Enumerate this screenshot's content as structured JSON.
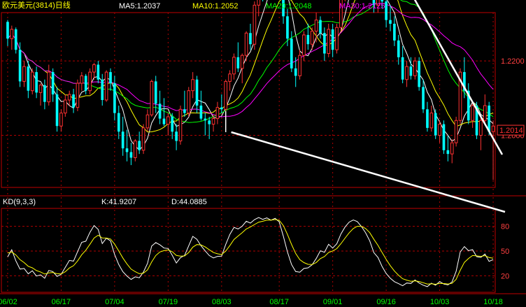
{
  "header": {
    "title": "欧元美元(3814)日线",
    "ma_labels": [
      {
        "text": "MA5:1.2037",
        "color": "#ffffff"
      },
      {
        "text": "MA10:1.2052",
        "color": "#ffff00"
      },
      {
        "text": "MA20:1.2048",
        "color": "#00ff00"
      },
      {
        "text": "MA30:1.2125",
        "color": "#ff00ff"
      }
    ]
  },
  "colors": {
    "up": "#ff3232",
    "down": "#00ffff",
    "grid": "#b00000",
    "axis": "#c00000",
    "ma5": "#ffffff",
    "ma10": "#ffff00",
    "ma20": "#00ff00",
    "ma30": "#ff00ff",
    "k_line": "#ffffff",
    "d_line": "#ffff00",
    "trend": "#ffffff",
    "label_green": "#00ff00"
  },
  "chart_data": [
    {
      "type": "candlestick",
      "title": "欧元美元(3814)日线",
      "x": [
        "06/02",
        "06/17",
        "07/04",
        "07/19",
        "08/03",
        "08/17",
        "09/01",
        "09/16",
        "10/03",
        "10/18"
      ],
      "ylim": [
        1.186,
        1.233
      ],
      "yticks": [
        1.2,
        1.22,
        1.24
      ],
      "current_price": 1.2014,
      "ohlc": [
        [
          1.2305,
          1.231,
          1.224,
          1.226
        ],
        [
          1.226,
          1.2295,
          1.223,
          1.2285
        ],
        [
          1.2285,
          1.229,
          1.222,
          1.223
        ],
        [
          1.223,
          1.225,
          1.213,
          1.2145
        ],
        [
          1.2145,
          1.22,
          1.213,
          1.2185
        ],
        [
          1.2185,
          1.22,
          1.21,
          1.212
        ],
        [
          1.212,
          1.218,
          1.211,
          1.217
        ],
        [
          1.217,
          1.2185,
          1.21,
          1.2115
        ],
        [
          1.2115,
          1.214,
          1.208,
          1.2135
        ],
        [
          1.2135,
          1.215,
          1.207,
          1.209
        ],
        [
          1.209,
          1.219,
          1.208,
          1.217
        ],
        [
          1.217,
          1.218,
          1.209,
          1.211
        ],
        [
          1.211,
          1.213,
          1.201,
          1.2025
        ],
        [
          1.2025,
          1.207,
          1.201,
          1.206
        ],
        [
          1.206,
          1.211,
          1.205,
          1.2095
        ],
        [
          1.2095,
          1.212,
          1.208,
          1.211
        ],
        [
          1.211,
          1.2125,
          1.206,
          1.2075
        ],
        [
          1.2075,
          1.215,
          1.2065,
          1.214
        ],
        [
          1.214,
          1.217,
          1.212,
          1.216
        ],
        [
          1.216,
          1.2165,
          1.211,
          1.212
        ],
        [
          1.212,
          1.218,
          1.211,
          1.217
        ],
        [
          1.217,
          1.2195,
          1.215,
          1.219
        ],
        [
          1.219,
          1.22,
          1.214,
          1.215
        ],
        [
          1.215,
          1.2165,
          1.208,
          1.2095
        ],
        [
          1.2095,
          1.2175,
          1.209,
          1.217
        ],
        [
          1.217,
          1.218,
          1.212,
          1.214
        ],
        [
          1.214,
          1.216,
          1.204,
          1.206
        ],
        [
          1.206,
          1.208,
          1.199,
          1.201
        ],
        [
          1.201,
          1.205,
          1.1945,
          1.1965
        ],
        [
          1.1965,
          1.2015,
          1.193,
          1.1955
        ],
        [
          1.1955,
          1.198,
          1.192,
          1.194
        ],
        [
          1.194,
          1.199,
          1.193,
          1.1985
        ],
        [
          1.1985,
          1.201,
          1.195,
          1.196
        ],
        [
          1.196,
          1.203,
          1.195,
          1.202
        ],
        [
          1.202,
          1.207,
          1.201,
          1.2055
        ],
        [
          1.2055,
          1.215,
          1.205,
          1.2145
        ],
        [
          1.2145,
          1.216,
          1.206,
          1.2085
        ],
        [
          1.2085,
          1.212,
          1.203,
          1.2045
        ],
        [
          1.2045,
          1.21,
          1.2025,
          1.203
        ],
        [
          1.203,
          1.206,
          1.2,
          1.205
        ],
        [
          1.205,
          1.206,
          1.199,
          1.201
        ],
        [
          1.201,
          1.203,
          1.196,
          1.1985
        ],
        [
          1.1985,
          1.208,
          1.1975,
          1.207
        ],
        [
          1.207,
          1.212,
          1.205,
          1.206
        ],
        [
          1.206,
          1.213,
          1.205,
          1.212
        ],
        [
          1.212,
          1.217,
          1.21,
          1.215
        ],
        [
          1.215,
          1.216,
          1.206,
          1.208
        ],
        [
          1.208,
          1.212,
          1.204,
          1.2045
        ],
        [
          1.2045,
          1.206,
          1.2,
          1.204
        ],
        [
          1.204,
          1.205,
          1.199,
          1.203
        ],
        [
          1.203,
          1.2055,
          1.201,
          1.2045
        ],
        [
          1.2045,
          1.209,
          1.203,
          1.2075
        ],
        [
          1.2075,
          1.211,
          1.206,
          1.207
        ],
        [
          1.207,
          1.215,
          1.2065,
          1.2145
        ],
        [
          1.2145,
          1.2175,
          1.212,
          1.2165
        ],
        [
          1.2165,
          1.222,
          1.215,
          1.221
        ],
        [
          1.221,
          1.225,
          1.217,
          1.218
        ],
        [
          1.218,
          1.222,
          1.214,
          1.2215
        ],
        [
          1.2215,
          1.228,
          1.22,
          1.2275
        ],
        [
          1.2275,
          1.23,
          1.223,
          1.2245
        ],
        [
          1.2245,
          1.236,
          1.223,
          1.235
        ],
        [
          1.235,
          1.24,
          1.232,
          1.2385
        ],
        [
          1.2385,
          1.243,
          1.236,
          1.238
        ],
        [
          1.238,
          1.246,
          1.237,
          1.244
        ],
        [
          1.244,
          1.247,
          1.239,
          1.241
        ],
        [
          1.241,
          1.249,
          1.24,
          1.247
        ],
        [
          1.247,
          1.25,
          1.241,
          1.243
        ],
        [
          1.243,
          1.245,
          1.23,
          1.232
        ],
        [
          1.232,
          1.234,
          1.224,
          1.226
        ],
        [
          1.226,
          1.228,
          1.217,
          1.218
        ],
        [
          1.218,
          1.221,
          1.213,
          1.216
        ],
        [
          1.216,
          1.223,
          1.215,
          1.2215
        ],
        [
          1.2215,
          1.228,
          1.22,
          1.227
        ],
        [
          1.227,
          1.23,
          1.223,
          1.2245
        ],
        [
          1.2245,
          1.229,
          1.223,
          1.228
        ],
        [
          1.228,
          1.233,
          1.225,
          1.231
        ],
        [
          1.231,
          1.232,
          1.226,
          1.2275
        ],
        [
          1.2275,
          1.229,
          1.22,
          1.222
        ],
        [
          1.222,
          1.23,
          1.221,
          1.2285
        ],
        [
          1.2285,
          1.23,
          1.221,
          1.223
        ],
        [
          1.223,
          1.23,
          1.222,
          1.229
        ],
        [
          1.229,
          1.238,
          1.228,
          1.237
        ],
        [
          1.237,
          1.246,
          1.236,
          1.245
        ],
        [
          1.245,
          1.252,
          1.243,
          1.251
        ],
        [
          1.251,
          1.262,
          1.249,
          1.259
        ],
        [
          1.259,
          1.264,
          1.254,
          1.256
        ],
        [
          1.256,
          1.258,
          1.247,
          1.25
        ],
        [
          1.25,
          1.253,
          1.243,
          1.2455
        ],
        [
          1.2455,
          1.248,
          1.238,
          1.24
        ],
        [
          1.24,
          1.242,
          1.233,
          1.235
        ],
        [
          1.235,
          1.244,
          1.233,
          1.2425
        ],
        [
          1.2425,
          1.243,
          1.234,
          1.236
        ],
        [
          1.236,
          1.237,
          1.229,
          1.231
        ],
        [
          1.231,
          1.235,
          1.228,
          1.23
        ],
        [
          1.23,
          1.232,
          1.224,
          1.2255
        ],
        [
          1.2255,
          1.227,
          1.219,
          1.221
        ],
        [
          1.221,
          1.224,
          1.214,
          1.215
        ],
        [
          1.215,
          1.22,
          1.213,
          1.2185
        ],
        [
          1.2185,
          1.221,
          1.215,
          1.216
        ],
        [
          1.216,
          1.221,
          1.215,
          1.22
        ],
        [
          1.22,
          1.221,
          1.212,
          1.213
        ],
        [
          1.213,
          1.215,
          1.206,
          1.207
        ],
        [
          1.207,
          1.209,
          1.201,
          1.202
        ],
        [
          1.202,
          1.208,
          1.201,
          1.206
        ],
        [
          1.206,
          1.207,
          1.199,
          1.2
        ],
        [
          1.2,
          1.204,
          1.198,
          1.203
        ],
        [
          1.203,
          1.204,
          1.195,
          1.196
        ],
        [
          1.196,
          1.2,
          1.193,
          1.195
        ],
        [
          1.195,
          1.199,
          1.1925,
          1.198
        ],
        [
          1.198,
          1.205,
          1.197,
          1.204
        ],
        [
          1.204,
          1.218,
          1.203,
          1.217
        ],
        [
          1.217,
          1.221,
          1.21,
          1.212
        ],
        [
          1.212,
          1.214,
          1.203,
          1.204
        ],
        [
          1.204,
          1.209,
          1.202,
          1.208
        ],
        [
          1.208,
          1.209,
          1.199,
          1.2
        ],
        [
          1.2,
          1.205,
          1.196,
          1.204
        ],
        [
          1.204,
          1.211,
          1.203,
          1.208
        ],
        [
          1.208,
          1.209,
          1.2,
          1.201
        ],
        [
          1.201,
          1.204,
          1.188,
          1.2025
        ]
      ]
    },
    {
      "type": "line",
      "title": "KD(9,3,3)",
      "series": [
        {
          "name": "K:41.9207"
        },
        {
          "name": "D:44.0885"
        }
      ],
      "ylim": [
        0,
        100
      ],
      "yticks": [
        20,
        50,
        80
      ]
    }
  ]
}
